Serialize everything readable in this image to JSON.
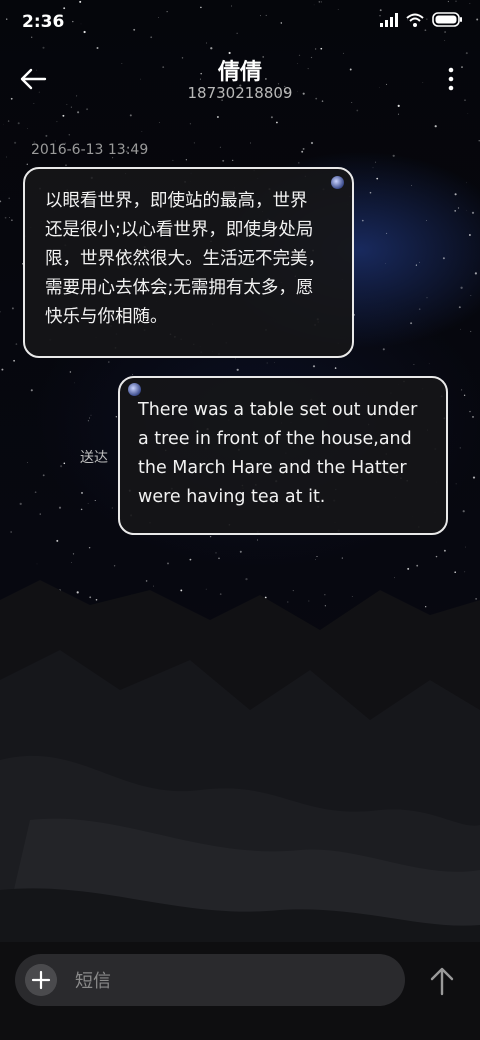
{
  "status_bar": {
    "time": "2:36",
    "icons": [
      "signal-icon",
      "wifi-icon",
      "battery-icon"
    ]
  },
  "header": {
    "contact_name": "倩倩",
    "contact_number": "18730218809",
    "back_icon": "back-arrow-icon",
    "more_icon": "more-vertical-icon"
  },
  "conversation": {
    "timestamp": "2016-6-13 13:49",
    "messages": [
      {
        "direction": "incoming",
        "lines": [
          "以眼看世界，即使站的最高，世界",
          "还是很小;以心看世界，即使身处局",
          "限，世界依然很大。生活远不完美，",
          "需要用心去体会;无需拥有太多，愿",
          "快乐与你相随。"
        ]
      },
      {
        "direction": "outgoing",
        "status": "送达",
        "lines": [
          "There was a table set out under",
          "a tree in front of the house,and",
          "the March Hare and the Hatter",
          "were having tea at it."
        ]
      }
    ]
  },
  "composer": {
    "placeholder": "短信",
    "value": "",
    "add_icon": "plus-icon",
    "send_icon": "send-arrow-icon"
  },
  "colors": {
    "bubble_border": "#e9e9e9",
    "bubble_fill": "#161618",
    "composer_fill": "#2a2a2d",
    "timestamp_text": "#9a9a9a"
  }
}
